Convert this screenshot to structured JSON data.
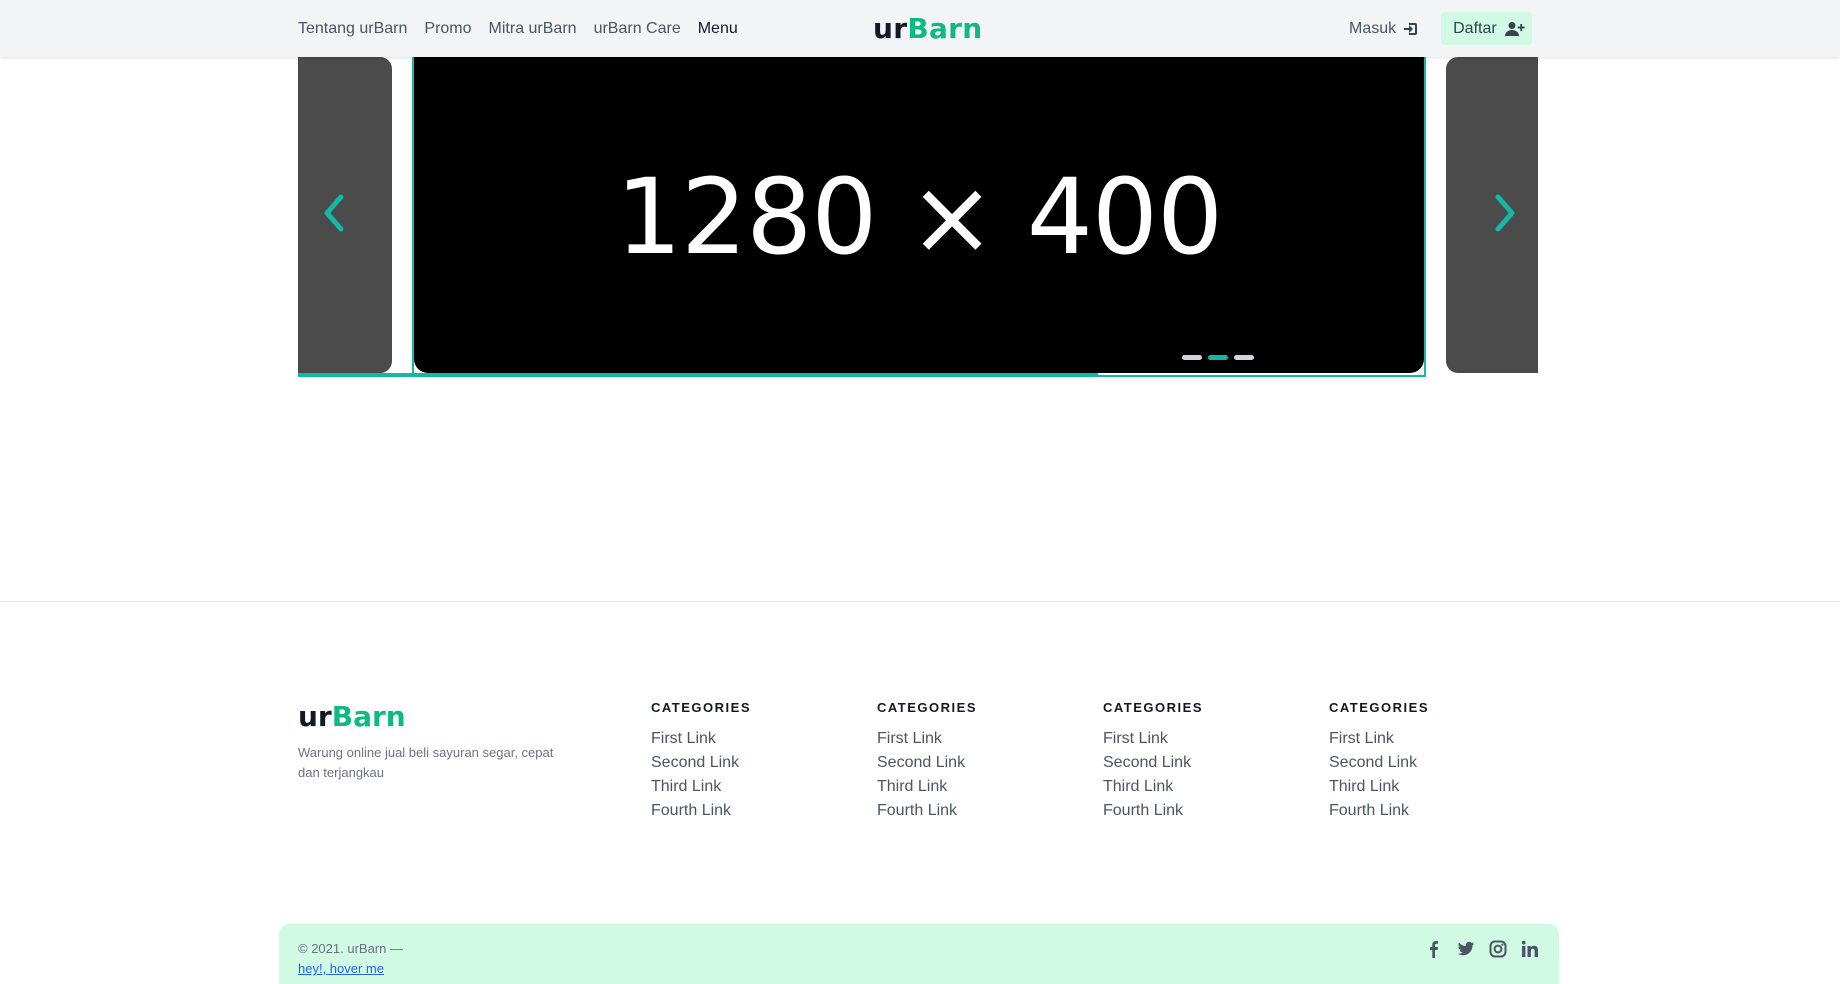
{
  "header": {
    "nav": [
      {
        "label": "Tentang urBarn"
      },
      {
        "label": "Promo"
      },
      {
        "label": "Mitra urBarn"
      },
      {
        "label": "urBarn Care"
      },
      {
        "label": "Menu"
      }
    ],
    "brand": {
      "part1": "ur",
      "part2": "Barn"
    },
    "login_label": "Masuk",
    "register_label": "Daftar"
  },
  "carousel": {
    "slide_text": "1280 × 400",
    "slide_count": 3,
    "active_index": 1,
    "progress_fraction": 0.645
  },
  "footer": {
    "brand": {
      "part1": "ur",
      "part2": "Barn"
    },
    "description": "Warung online jual beli sayuran segar, cepat dan terjangkau",
    "columns": [
      {
        "title": "CATEGORIES",
        "links": [
          "First Link",
          "Second Link",
          "Third Link",
          "Fourth Link"
        ]
      },
      {
        "title": "CATEGORIES",
        "links": [
          "First Link",
          "Second Link",
          "Third Link",
          "Fourth Link"
        ]
      },
      {
        "title": "CATEGORIES",
        "links": [
          "First Link",
          "Second Link",
          "Third Link",
          "Fourth Link"
        ]
      },
      {
        "title": "CATEGORIES",
        "links": [
          "First Link",
          "Second Link",
          "Third Link",
          "Fourth Link"
        ]
      }
    ],
    "copyright": "© 2021. urBarn —",
    "hover_link": "hey!, hover me",
    "socials": [
      "facebook-icon",
      "twitter-icon",
      "instagram-icon",
      "linkedin-icon"
    ]
  },
  "colors": {
    "brand_green": "#10b981",
    "accent_teal": "#14b8a6",
    "mint_bg": "#d1fae5",
    "header_bg": "#f3f4f6"
  }
}
